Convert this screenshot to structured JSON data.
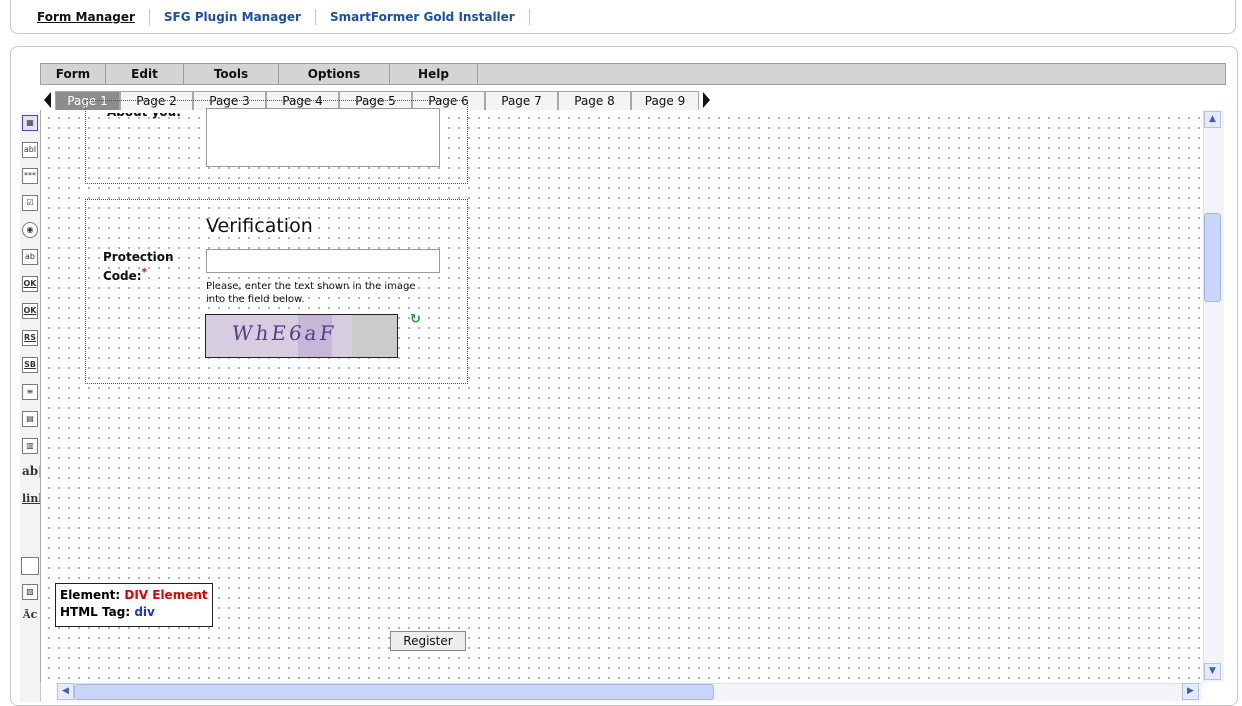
{
  "topnav": {
    "links": [
      "Form Manager",
      "SFG Plugin Manager",
      "SmartFormer Gold Installer"
    ]
  },
  "menu": [
    "Form",
    "Edit",
    "Tools",
    "Options",
    "Help"
  ],
  "pages": [
    "Page 1",
    "Page 2",
    "Page 3",
    "Page 4",
    "Page 5",
    "Page 6",
    "Page 7",
    "Page 8",
    "Page 9"
  ],
  "active_page": "Page 1",
  "toolbox": {
    "icons": [
      "pointer-icon",
      "textfield-icon",
      "password-icon",
      "checkbox-icon",
      "radio-icon",
      "textarea-icon",
      "ok-button-1-icon",
      "ok-button-2-icon",
      "reset-icon",
      "submit-icon",
      "list-icon",
      "select-icon",
      "multiselect-icon",
      "label-icon",
      "link-icon",
      "div-icon",
      "image-icon",
      "spellcheck-icon"
    ],
    "labels": {
      "textfield": "abl",
      "password": "***",
      "checkbox": "☑",
      "radio": "◉",
      "ok1": "OK",
      "ok2": "OK",
      "reset": "RS",
      "submit": "SB",
      "label": "ab|",
      "link": "link"
    }
  },
  "form": {
    "about_label": "About you:",
    "verification_heading": "Verification",
    "protection_label_1": "Protection",
    "protection_label_2": "Code:",
    "required_mark": "*",
    "hint_1": "Please, enter the text shown in the image",
    "hint_2": "into the field below.",
    "captcha_text": "WhE6aF",
    "register_label": "Register"
  },
  "tooltip": {
    "element_label": "Element:",
    "element_value": "DIV Element",
    "tag_label": "HTML Tag:",
    "tag_value": "div"
  },
  "colors": {
    "link_blue": "#1c4fa8",
    "required_red": "#e00000",
    "tag_blue": "#1f34d0",
    "group_border": "#3050c8"
  }
}
